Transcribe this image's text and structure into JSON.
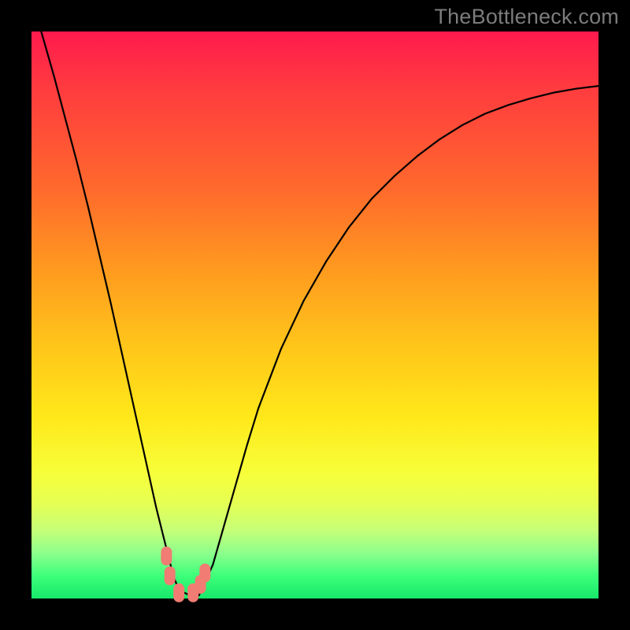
{
  "watermark": "TheBottleneck.com",
  "colors": {
    "background": "#000000",
    "gradient_top": "#ff1a4d",
    "gradient_bottom": "#17e86a",
    "curve": "#000000",
    "marker": "#f07c73"
  },
  "chart_data": {
    "type": "line",
    "title": "",
    "xlabel": "",
    "ylabel": "",
    "xlim": [
      0,
      100
    ],
    "ylim": [
      0,
      100
    ],
    "x": [
      0,
      2,
      4,
      6,
      8,
      10,
      12,
      14,
      16,
      18,
      20,
      22,
      24,
      25,
      26,
      28,
      29.5,
      30,
      32,
      34,
      36,
      38,
      40,
      44,
      48,
      52,
      56,
      60,
      64,
      68,
      72,
      76,
      80,
      84,
      88,
      92,
      96,
      100
    ],
    "values": [
      106,
      99,
      92,
      84.5,
      77,
      69,
      60.5,
      52,
      43,
      34,
      25,
      16,
      8,
      4,
      1.5,
      0.5,
      0.5,
      1.5,
      6,
      13,
      20,
      27,
      33.5,
      44,
      52.5,
      59.5,
      65.5,
      70.5,
      74.5,
      78,
      81,
      83.5,
      85.5,
      87,
      88.2,
      89.2,
      89.9,
      90.4
    ],
    "minimum_x": 27,
    "markers": [
      {
        "x": 23.8,
        "y": 7.5
      },
      {
        "x": 24.4,
        "y": 4.0
      },
      {
        "x": 26.0,
        "y": 1.0
      },
      {
        "x": 28.5,
        "y": 1.0
      },
      {
        "x": 29.8,
        "y": 2.5
      },
      {
        "x": 30.6,
        "y": 4.5
      }
    ]
  }
}
